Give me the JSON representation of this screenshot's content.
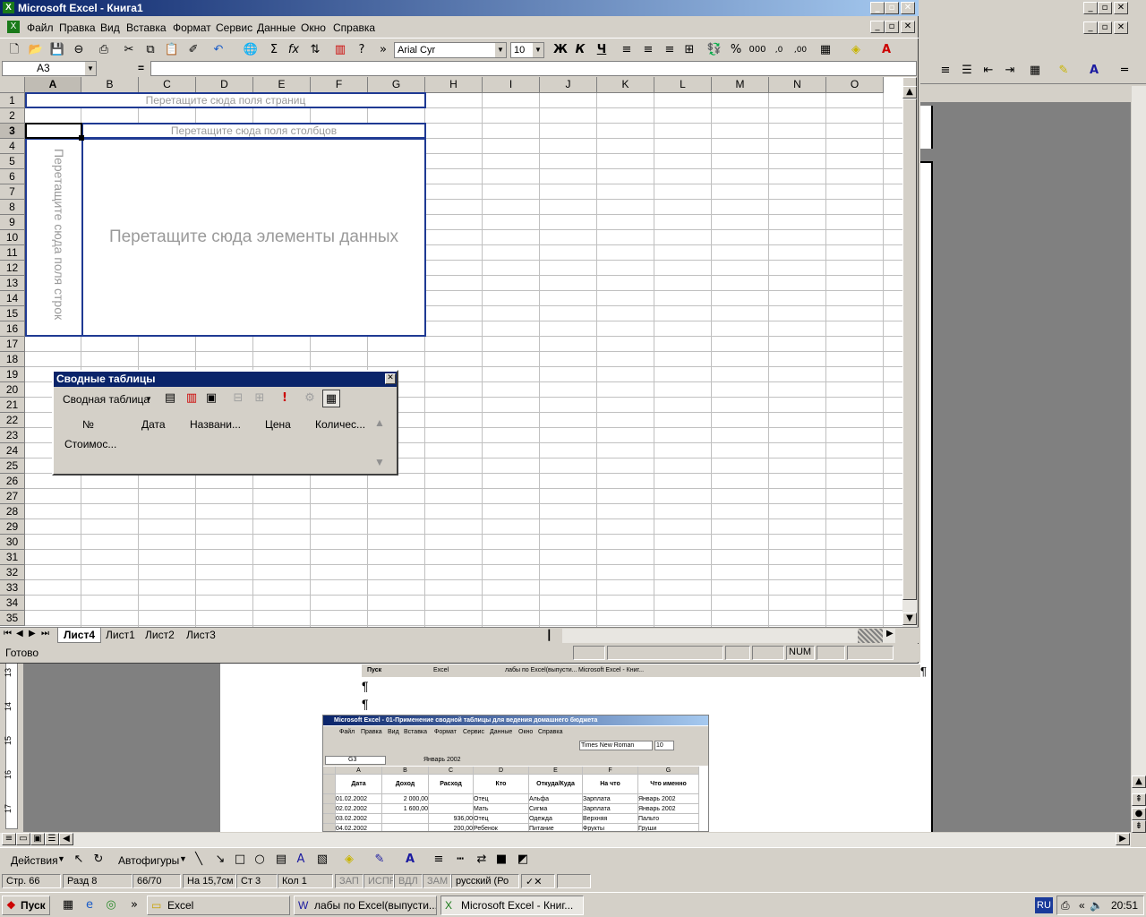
{
  "excel": {
    "title": "Microsoft Excel - Книга1",
    "menu": [
      "Файл",
      "Правка",
      "Вид",
      "Вставка",
      "Формат",
      "Сервис",
      "Данные",
      "Окно",
      "Справка"
    ],
    "font_name": "Arial Cyr",
    "font_size": "10",
    "name_box": "A3",
    "formula_eq": "=",
    "columns": [
      "A",
      "B",
      "C",
      "D",
      "E",
      "F",
      "G",
      "H",
      "I",
      "J",
      "K",
      "L",
      "M",
      "N",
      "O"
    ],
    "rows": [
      "1",
      "2",
      "3",
      "4",
      "5",
      "6",
      "7",
      "8",
      "9",
      "10",
      "11",
      "12",
      "13",
      "14",
      "15",
      "16",
      "17",
      "18",
      "19",
      "20",
      "21",
      "22",
      "23",
      "24",
      "25",
      "26",
      "27",
      "28",
      "29",
      "30",
      "31",
      "32",
      "33",
      "34",
      "35"
    ],
    "pivot": {
      "page_fields": "Перетащите сюда поля страниц",
      "col_fields": "Перетащите сюда поля столбцов",
      "row_fields": "Перетащите сюда поля строк",
      "data_items": "Перетащите сюда элементы данных"
    },
    "sheet_tabs": [
      "Лист4",
      "Лист1",
      "Лист2",
      "Лист3"
    ],
    "status": "Готово",
    "num_indicator": "NUM"
  },
  "pivot_toolbar": {
    "title": "Сводные таблицы",
    "menu_label": "Сводная таблица",
    "fields": [
      "№",
      "Дата",
      "Названи...",
      "Цена",
      "Количес...",
      "Стоимос..."
    ]
  },
  "embedded": {
    "taskbar_items": [
      "Пуск",
      "Excel",
      "лабы по Excel(выпусти...",
      "Microsoft Excel - Книг..."
    ],
    "title": "Microsoft Excel - 01-Применение сводной таблицы для ведения домашнего бюджета",
    "menu": [
      "Файл",
      "Правка",
      "Вид",
      "Вставка",
      "Формат",
      "Сервис",
      "Данные",
      "Окно",
      "Справка"
    ],
    "font_name": "Times New Roman",
    "font_size": "10",
    "cell_ref": "G3",
    "formula_value": "Январь 2002",
    "columns": [
      "A",
      "B",
      "C",
      "D",
      "E",
      "F",
      "G"
    ],
    "headers": [
      "Дата",
      "Доход",
      "Расход",
      "Кто",
      "Откуда/Куда",
      "На что",
      "Что именно"
    ],
    "rows": [
      [
        "01.02.2002",
        "2 000,00",
        "",
        "Отец",
        "Альфа",
        "Зарплата",
        "Январь 2002"
      ],
      [
        "02.02.2002",
        "1 600,00",
        "",
        "Мать",
        "Сигма",
        "Зарплата",
        "Январь 2002"
      ],
      [
        "03.02.2002",
        "",
        "936,00",
        "Отец",
        "Одежда",
        "Верхняя",
        "Пальто"
      ],
      [
        "04.02.2002",
        "",
        "200,00",
        "Ребенок",
        "Питание",
        "Фрукты",
        "Груши"
      ]
    ]
  },
  "word": {
    "draw_toolbar": {
      "actions": "Действия",
      "autoshapes": "Автофигуры"
    },
    "status": {
      "page": "Стр. 66",
      "section": "Разд 8",
      "pages": "66/70",
      "at": "На 15,7см",
      "line": "Ст 3",
      "col": "Кол 1",
      "rec": "ЗАП",
      "trk": "ИСПР",
      "ext": "ВДЛ",
      "ovr": "ЗАМ",
      "lang": "русский (Ро"
    },
    "ruler_marks": [
      "13",
      "14",
      "15",
      "16",
      "17"
    ]
  },
  "taskbar": {
    "start": "Пуск",
    "items": [
      "Excel",
      "лабы по Excel(выпусти...",
      "Microsoft Excel - Книг..."
    ],
    "lang": "RU",
    "time": "20:51"
  }
}
